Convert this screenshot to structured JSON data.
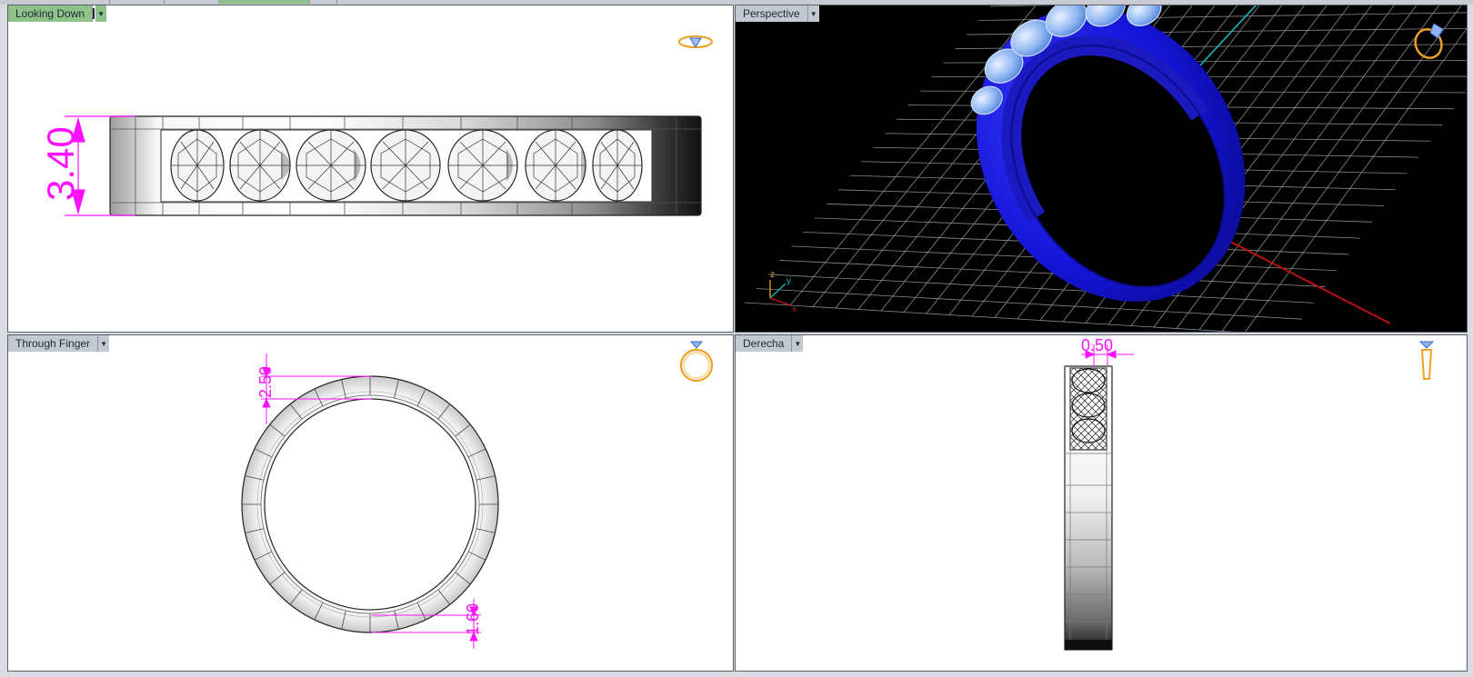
{
  "viewports": {
    "top": {
      "label": "Looking Down",
      "dimension": "3.40"
    },
    "perspective": {
      "label": "Perspective",
      "axes": {
        "x": "x",
        "y": "y",
        "z": "z"
      }
    },
    "front": {
      "label": "Through Finger",
      "dim_top": "2.50",
      "dim_bottom": "1.60"
    },
    "right": {
      "label": "Derecha",
      "dim_width": "0.50"
    }
  },
  "icons": {
    "top": "ring-top-view-icon",
    "perspective": "ring-perspective-icon",
    "front": "ring-front-view-icon",
    "right": "ring-side-view-icon",
    "dropdown": "chevron-down-icon"
  },
  "colors": {
    "dimension": "#ff10ff",
    "ring_blue": "#1212d8",
    "active_tab": "#8fc28b",
    "tab": "#c3c9d1",
    "grid": "#8a8a8a",
    "axis_red": "#d01010",
    "axis_cyan": "#16b8c0"
  }
}
